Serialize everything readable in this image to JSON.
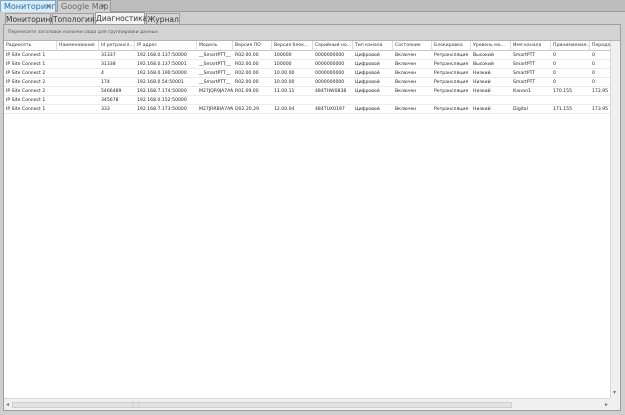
{
  "doc_tabs": [
    {
      "label": "Мониторинг"
    },
    {
      "label": "Google Map"
    }
  ],
  "inner_tabs": [
    {
      "label": "Мониторинг"
    },
    {
      "label": "Топология"
    },
    {
      "label": "Диагностика"
    },
    {
      "label": "Журнал"
    }
  ],
  "group_hint": "Перенесите заголовок колонки сюда для группировки данных",
  "columns": [
    "Радиосеть",
    "Наименование",
    "Id ретрансл...",
    "IP адрес",
    "Модель",
    "Версия ПО",
    "Версия блок...",
    "Серийный но...",
    "Тип канала",
    "Состояние",
    "Блокировка",
    "Уровень мо...",
    "Имя канала",
    "Принимаемая...",
    "Передаваем..."
  ],
  "rows": [
    [
      "IP Site Connect 1",
      "",
      "31337",
      "192.168.0.137:50000",
      "__SmartPTT__",
      "R02.00.00",
      "100000",
      "0000000000",
      "Цифровой",
      "Включен",
      "Ретрансляция",
      "Высокий",
      "SmartPTT",
      "0",
      "0"
    ],
    [
      "IP Site Connect 1",
      "",
      "31338",
      "192.168.0.137:50001",
      "__SmartPTT__",
      "R02.00.00",
      "100000",
      "0000000000",
      "Цифровой",
      "Включен",
      "Ретрансляция",
      "Высокий",
      "SmartPTT",
      "0",
      "0"
    ],
    [
      "IP Site Connect 2",
      "",
      "4",
      "192.168.0.190:50000",
      "__SmartPTT__",
      "R02.00.00",
      "10.00.00",
      "0000000000",
      "Цифровой",
      "Включен",
      "Ретрансляция",
      "Низкий",
      "SmartPTT",
      "0",
      "0"
    ],
    [
      "IP Site Connect 2",
      "",
      "174",
      "192.168.0.54:50001",
      "__SmartPTT__",
      "R02.00.00",
      "10.00.00",
      "0000000000",
      "Цифровой",
      "Включен",
      "Ретрансляция",
      "Низкий",
      "SmartPTT",
      "0",
      "0"
    ],
    [
      "IP Site Connect 2",
      "",
      "5466489",
      "192.168.7.174:50000",
      "M27JQR9JA7AN",
      "R01.09.00",
      "11.00.11",
      "484THW0838",
      "Цифровой",
      "Включен",
      "Ретрансляция",
      "Низкий",
      "Канал1",
      "170.155",
      "172.95"
    ],
    [
      "IP Site Connect 1",
      "",
      "345678",
      "192.168.0.152:50000",
      "",
      "",
      "",
      "",
      "",
      "",
      "",
      "",
      "",
      "",
      ""
    ],
    [
      "IP Site Connect 1",
      "",
      "333",
      "192.168.7.173:50000",
      "M27JRRBIA7AN",
      "D02.20.29",
      "12.00.04",
      "484TUX0197",
      "Цифровой",
      "Включен",
      "Ретрансляция",
      "Низкий",
      "Digital",
      "171.155",
      "173.95"
    ]
  ]
}
